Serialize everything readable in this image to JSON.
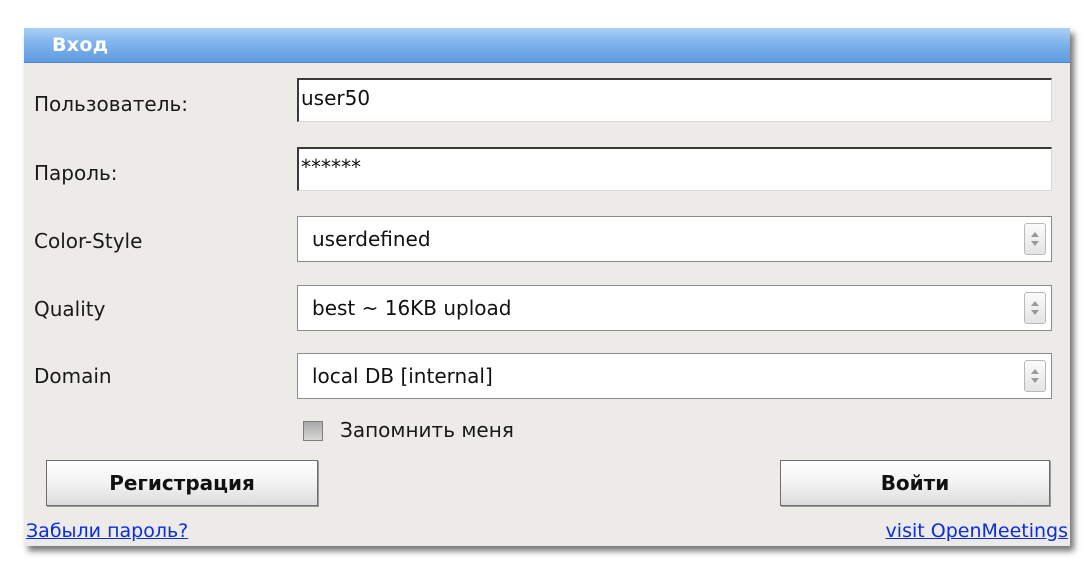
{
  "dialog": {
    "title": "Вход"
  },
  "form": {
    "username_label": "Пользователь:",
    "username_value": "user50",
    "password_label": "Пароль:",
    "password_value": "******",
    "color_style_label": "Color-Style",
    "color_style_value": "userdefined",
    "quality_label": "Quality",
    "quality_value": "best ~ 16KB upload",
    "domain_label": "Domain",
    "domain_value": "local DB [internal]",
    "remember_label": "Запомнить меня",
    "remember_checked": false
  },
  "buttons": {
    "register_label": "Регистрация",
    "login_label": "Войти"
  },
  "links": {
    "forgot_password": "Забыли пароль?",
    "visit": "visit OpenMeetings"
  },
  "colors": {
    "titlebar": "#7fb3ec",
    "panel_bg": "#ecebe7",
    "link": "#0b2de0"
  }
}
